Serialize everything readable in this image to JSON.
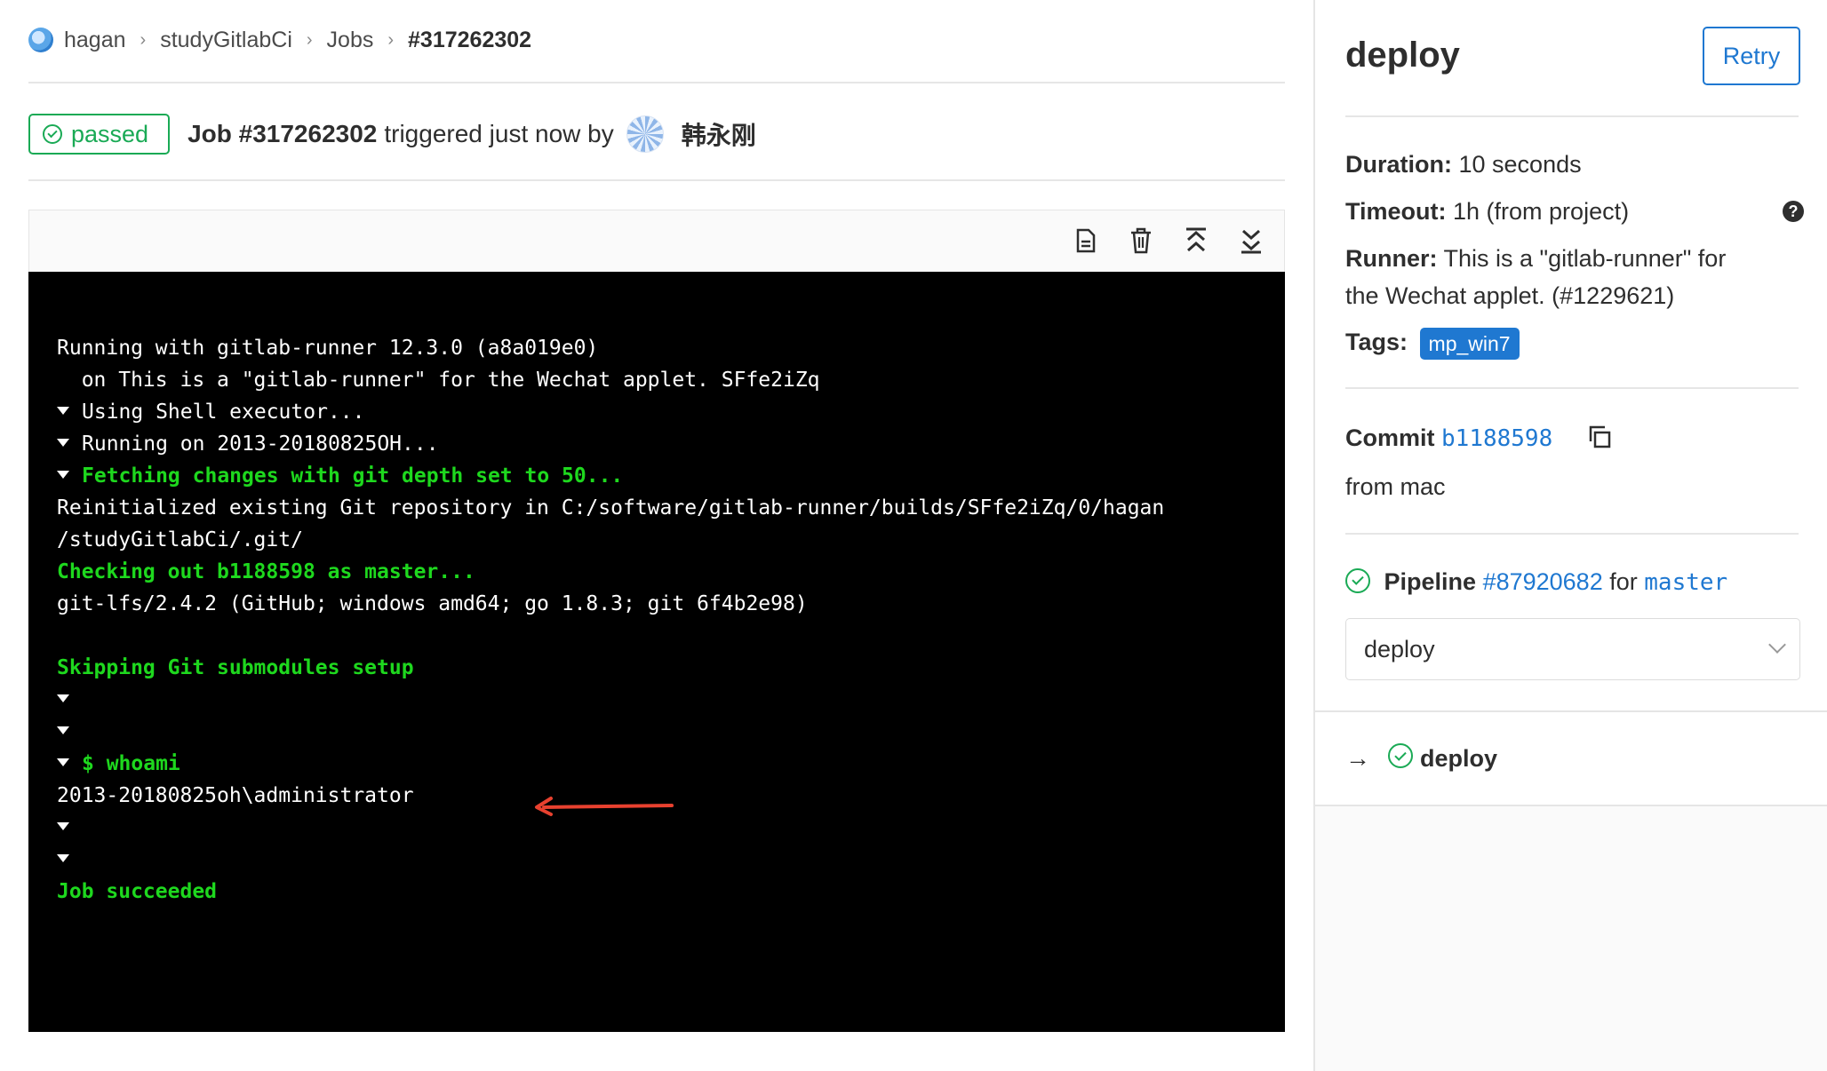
{
  "breadcrumb": {
    "items": [
      "hagan",
      "studyGitlabCi",
      "Jobs"
    ],
    "current": "#317262302",
    "separator": "›"
  },
  "status": {
    "badge": "passed",
    "job_label": "Job #317262302",
    "triggered_text": "triggered just now by",
    "user": "韩永刚"
  },
  "toolbar": {
    "icons": [
      "raw-log-icon",
      "erase-log-icon",
      "scroll-top-icon",
      "scroll-bottom-icon"
    ]
  },
  "log": {
    "lines": [
      {
        "text": "Running with gitlab-runner 12.3.0 (a8a019e0)",
        "style": "plain",
        "caret": false
      },
      {
        "text": "  on This is a \"gitlab-runner\" for the Wechat applet. SFfe2iZq",
        "style": "plain",
        "caret": false
      },
      {
        "text": "Using Shell executor...",
        "style": "plain",
        "caret": true
      },
      {
        "text": "Running on 2013-20180825OH...",
        "style": "plain",
        "caret": true
      },
      {
        "text": "Fetching changes with git depth set to 50...",
        "style": "green",
        "caret": true
      },
      {
        "text": "Reinitialized existing Git repository in C:/software/gitlab-runner/builds/SFfe2iZq/0/hagan",
        "style": "plain",
        "caret": false
      },
      {
        "text": "/studyGitlabCi/.git/",
        "style": "plain",
        "caret": false
      },
      {
        "text": "Checking out b1188598 as master...",
        "style": "green",
        "caret": false
      },
      {
        "text": "git-lfs/2.4.2 (GitHub; windows amd64; go 1.8.3; git 6f4b2e98)",
        "style": "plain",
        "caret": false
      },
      {
        "text": "",
        "style": "plain",
        "caret": false
      },
      {
        "text": "Skipping Git submodules setup",
        "style": "green",
        "caret": false
      },
      {
        "text": "",
        "style": "plain",
        "caret": true
      },
      {
        "text": "",
        "style": "plain",
        "caret": true
      },
      {
        "text": "$ whoami",
        "style": "green",
        "caret": true
      },
      {
        "text": "2013-20180825oh\\administrator",
        "style": "plain",
        "caret": false
      },
      {
        "text": "",
        "style": "plain",
        "caret": true
      },
      {
        "text": "",
        "style": "plain",
        "caret": true
      },
      {
        "text": "Job succeeded",
        "style": "green",
        "caret": false
      }
    ]
  },
  "sidebar": {
    "title": "deploy",
    "retry": "Retry",
    "duration_label": "Duration:",
    "duration_value": "10 seconds",
    "timeout_label": "Timeout:",
    "timeout_value": "1h (from project)",
    "runner_label": "Runner:",
    "runner_value_1": "This is a \"gitlab-runner\" for",
    "runner_value_2": "the Wechat applet. (#1229621)",
    "tags_label": "Tags:",
    "tag": "mp_win7",
    "commit_label": "Commit",
    "commit_sha": "b1188598",
    "commit_message": "from mac",
    "pipeline_label": "Pipeline",
    "pipeline_id": "#87920682",
    "pipeline_for": "for",
    "pipeline_branch": "master",
    "stage_selected": "deploy",
    "job_arrow": "→",
    "job_name": "deploy"
  },
  "colors": {
    "success": "#1aaa55",
    "link": "#1f78d1",
    "terminal_bg": "#000000",
    "terminal_green": "#1ed81e",
    "annotation_arrow": "#e8412f"
  }
}
